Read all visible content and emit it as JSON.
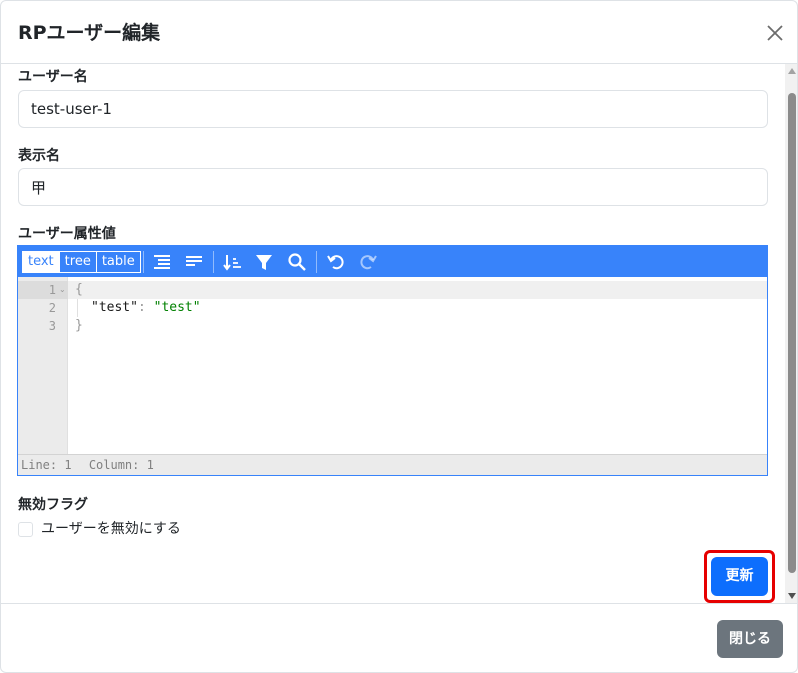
{
  "modal": {
    "title": "RPユーザー編集"
  },
  "form": {
    "username": {
      "label": "ユーザー名",
      "value": "test-user-1"
    },
    "display_name": {
      "label": "表示名",
      "value": "甲"
    },
    "attributes": {
      "label": "ユーザー属性値"
    },
    "disabled": {
      "label": "無効フラグ",
      "checkbox_label": "ユーザーを無効にする",
      "checked": false
    }
  },
  "json_editor": {
    "modes": [
      "text",
      "tree",
      "table"
    ],
    "active_mode": "text",
    "toolbar_icons": [
      "format-icon",
      "compact-icon",
      "sort-icon",
      "filter-icon",
      "search-icon",
      "undo-icon",
      "redo-icon"
    ],
    "line_numbers": [
      "1",
      "2",
      "3"
    ],
    "lines": {
      "open_brace": "{",
      "key": "\"test\"",
      "colon": ":",
      "value": "\"test\"",
      "close_brace": "}"
    },
    "status": {
      "line": "Line: 1",
      "column": "Column: 1"
    }
  },
  "buttons": {
    "update": "更新",
    "close": "閉じる"
  },
  "colors": {
    "primary": "#0d6efd",
    "secondary": "#6c757d",
    "editor_accent": "#3883fa",
    "highlight": "#e60000",
    "json_string": "#008000"
  }
}
